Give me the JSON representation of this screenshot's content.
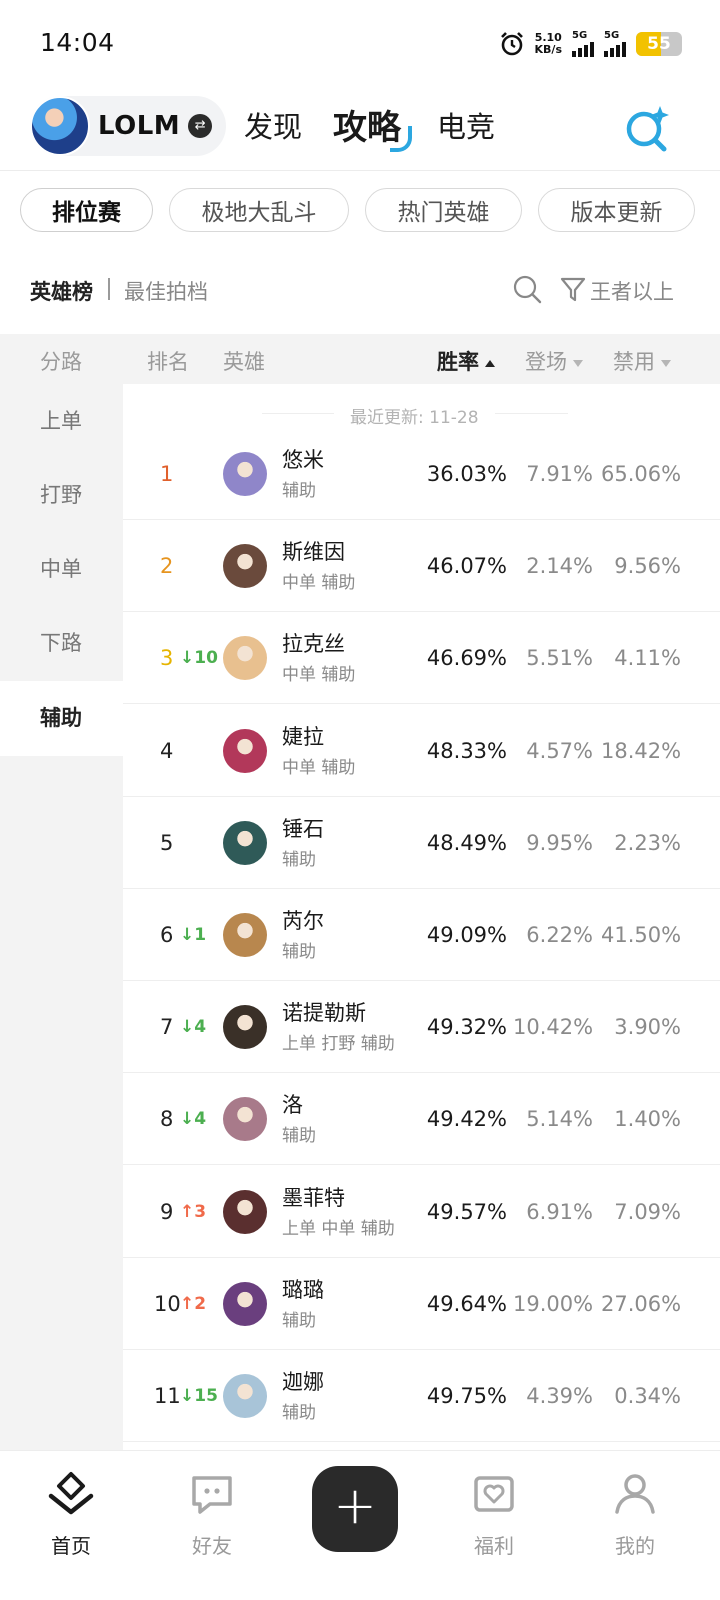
{
  "status_bar": {
    "time": "14:04",
    "net_speed_value": "5.10",
    "net_speed_unit": "KB/s",
    "sim1_label": "5G",
    "sim2_label": "5G",
    "battery": "55",
    "icons": [
      "alarm-icon",
      "signal-icon",
      "battery-icon"
    ]
  },
  "header": {
    "game_name": "LOLM",
    "tabs": [
      {
        "label": "发现",
        "active": false
      },
      {
        "label": "攻略",
        "active": true
      },
      {
        "label": "电竞",
        "active": false
      }
    ],
    "accent_color": "#2ca7e0"
  },
  "categories": [
    {
      "label": "排位赛",
      "active": true
    },
    {
      "label": "极地大乱斗",
      "active": false
    },
    {
      "label": "热门英雄",
      "active": false
    },
    {
      "label": "版本更新",
      "active": false
    }
  ],
  "subtabs": {
    "active": "英雄榜",
    "other": "最佳拍档",
    "filter_label": "王者以上"
  },
  "table": {
    "headers": {
      "lane": "分路",
      "rank": "排名",
      "hero": "英雄",
      "win_rate": "胜率",
      "pick_rate": "登场",
      "ban_rate": "禁用"
    },
    "update_text": "最近更新: 11-28",
    "lanes": [
      {
        "label": "上单",
        "active": false
      },
      {
        "label": "打野",
        "active": false
      },
      {
        "label": "中单",
        "active": false
      },
      {
        "label": "下路",
        "active": false
      },
      {
        "label": "辅助",
        "active": true
      }
    ],
    "rows": [
      {
        "rank": "1",
        "change": "",
        "dir": "",
        "name": "悠米",
        "lanes": "辅助",
        "win": "36.03%",
        "pick": "7.91%",
        "ban": "65.06%",
        "rank_color": "#e0602c",
        "avatar": "#8f86c9"
      },
      {
        "rank": "2",
        "change": "",
        "dir": "",
        "name": "斯维因",
        "lanes": "中单 辅助",
        "win": "46.07%",
        "pick": "2.14%",
        "ban": "9.56%",
        "rank_color": "#e6941f",
        "avatar": "#6a4a3c"
      },
      {
        "rank": "3",
        "change": "10",
        "dir": "down",
        "name": "拉克丝",
        "lanes": "中单 辅助",
        "win": "46.69%",
        "pick": "5.51%",
        "ban": "4.11%",
        "rank_color": "#e6b400",
        "avatar": "#e8c08f"
      },
      {
        "rank": "4",
        "change": "",
        "dir": "",
        "name": "婕拉",
        "lanes": "中单 辅助",
        "win": "48.33%",
        "pick": "4.57%",
        "ban": "18.42%",
        "rank_color": "#222222",
        "avatar": "#b2385a"
      },
      {
        "rank": "5",
        "change": "",
        "dir": "",
        "name": "锤石",
        "lanes": "辅助",
        "win": "48.49%",
        "pick": "9.95%",
        "ban": "2.23%",
        "rank_color": "#222222",
        "avatar": "#2f5a58"
      },
      {
        "rank": "6",
        "change": "1",
        "dir": "down",
        "name": "芮尔",
        "lanes": "辅助",
        "win": "49.09%",
        "pick": "6.22%",
        "ban": "41.50%",
        "rank_color": "#222222",
        "avatar": "#b8874e"
      },
      {
        "rank": "7",
        "change": "4",
        "dir": "down",
        "name": "诺提勒斯",
        "lanes": "上单 打野 辅助",
        "win": "49.32%",
        "pick": "10.42%",
        "ban": "3.90%",
        "rank_color": "#222222",
        "avatar": "#3a3028"
      },
      {
        "rank": "8",
        "change": "4",
        "dir": "down",
        "name": "洛",
        "lanes": "辅助",
        "win": "49.42%",
        "pick": "5.14%",
        "ban": "1.40%",
        "rank_color": "#222222",
        "avatar": "#a87a8a"
      },
      {
        "rank": "9",
        "change": "3",
        "dir": "up",
        "name": "墨菲特",
        "lanes": "上单 中单 辅助",
        "win": "49.57%",
        "pick": "6.91%",
        "ban": "7.09%",
        "rank_color": "#222222",
        "avatar": "#5a2f2f"
      },
      {
        "rank": "10",
        "change": "2",
        "dir": "up",
        "name": "璐璐",
        "lanes": "辅助",
        "win": "49.64%",
        "pick": "19.00%",
        "ban": "27.06%",
        "rank_color": "#222222",
        "avatar": "#6a3f7e"
      },
      {
        "rank": "11",
        "change": "15",
        "dir": "down",
        "name": "迦娜",
        "lanes": "辅助",
        "win": "49.75%",
        "pick": "4.39%",
        "ban": "0.34%",
        "rank_color": "#222222",
        "avatar": "#a8c4d8"
      }
    ]
  },
  "bottom_nav": [
    {
      "label": "首页",
      "icon": "home-icon",
      "active": true
    },
    {
      "label": "好友",
      "icon": "chat-icon",
      "active": false
    },
    {
      "label": "福利",
      "icon": "gift-icon",
      "active": false
    },
    {
      "label": "我的",
      "icon": "profile-icon",
      "active": false
    }
  ],
  "plus_label": "+"
}
